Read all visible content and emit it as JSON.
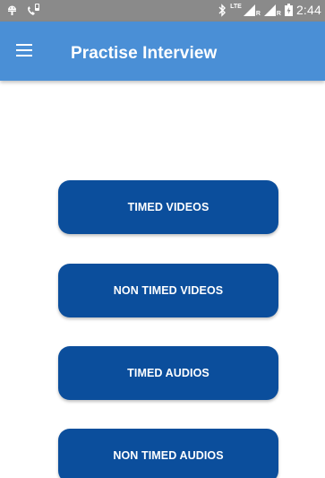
{
  "status_bar": {
    "time": "2:44",
    "network_label": "LTE",
    "roaming_label_1": "R",
    "roaming_label_2": "R",
    "icons": [
      "android-debug-icon",
      "phone-call-icon",
      "bluetooth-icon",
      "signal-lte-icon",
      "signal-icon",
      "battery-charging-icon"
    ]
  },
  "app_bar": {
    "title": "Practise Interview",
    "menu_icon": "hamburger-menu-icon",
    "background_color": "#4a8fd6"
  },
  "buttons": [
    {
      "label": "TIMED VIDEOS"
    },
    {
      "label": "NON TIMED VIDEOS"
    },
    {
      "label": "TIMED AUDIOS"
    },
    {
      "label": "NON TIMED AUDIOS"
    }
  ],
  "colors": {
    "button": "#0b4e9c",
    "status_bar": "#8a8a8a"
  }
}
